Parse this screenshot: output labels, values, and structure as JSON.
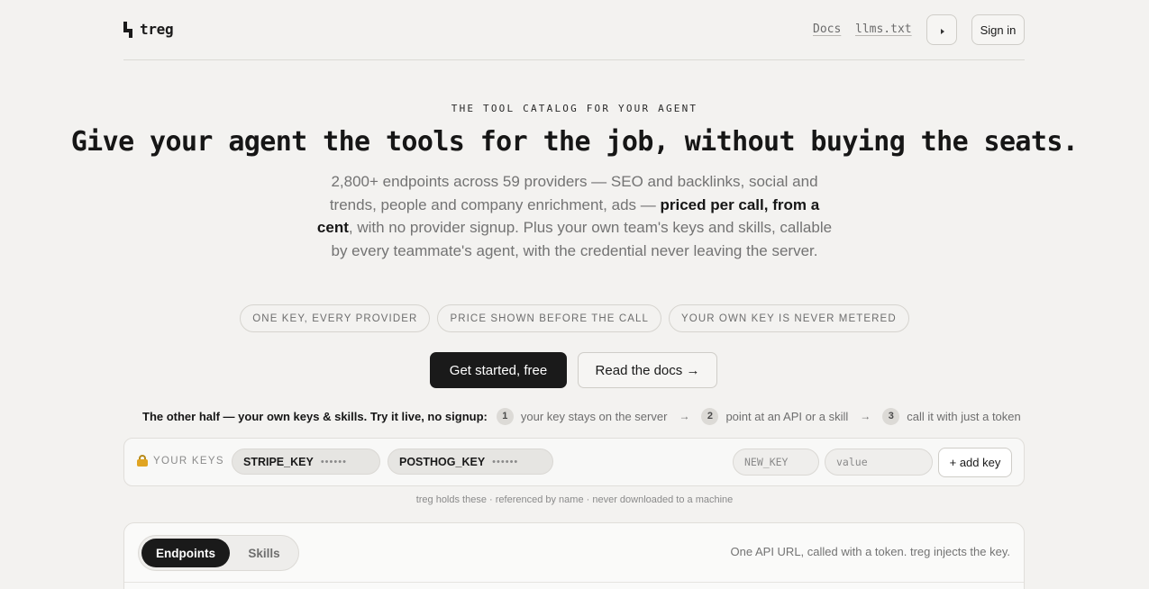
{
  "header": {
    "logo_text": "treg",
    "nav_docs": "Docs",
    "nav_llms": "llms.txt",
    "theme_toggle_icon": "play-icon",
    "signin_label": "Sign in"
  },
  "hero": {
    "eyebrow": "THE TOOL CATALOG FOR YOUR AGENT",
    "headline": "Give your agent the tools for the job, without buying the seats.",
    "sub_part1": "2,800+ endpoints across 59 providers — SEO and backlinks, social and trends, people and company enrichment, ads — ",
    "sub_bold": "priced per call, from a cent",
    "sub_part2": ", with no provider signup. Plus your own team's keys and skills, callable by every teammate's agent, with the credential never leaving the server.",
    "pills": [
      "ONE KEY, EVERY PROVIDER",
      "PRICE SHOWN BEFORE THE CALL",
      "YOUR OWN KEY IS NEVER METERED"
    ],
    "cta_primary": "Get started, free",
    "cta_secondary": "Read the docs →"
  },
  "steps": {
    "lead": "The other half — your own keys & skills. Try it live, no signup:",
    "items": [
      {
        "num": "1",
        "text": "your key stays on the server"
      },
      {
        "num": "2",
        "text": "point at an API or a skill"
      },
      {
        "num": "3",
        "text": "call it with just a token"
      }
    ],
    "arrow": "→"
  },
  "keys": {
    "label": "YOUR KEYS",
    "chips": [
      {
        "name": "STRIPE_KEY",
        "mask": "••••••"
      },
      {
        "name": "POSTHOG_KEY",
        "mask": "••••••"
      }
    ],
    "new_key_placeholder": "NEW_KEY",
    "value_placeholder": "value",
    "add_label": "+ add key",
    "note": "treg holds these · referenced by name · never downloaded to a machine"
  },
  "panel": {
    "tabs": [
      "Endpoints",
      "Skills"
    ],
    "active_tab": "Endpoints",
    "hint": "One API URL, called with a token. treg injects the key."
  }
}
